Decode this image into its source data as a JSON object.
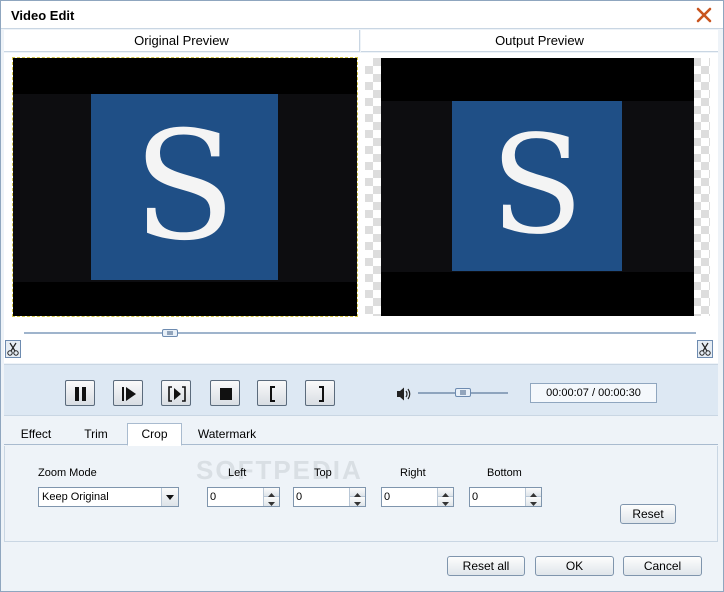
{
  "window": {
    "title": "Video Edit"
  },
  "preview": {
    "original_label": "Original Preview",
    "output_label": "Output Preview",
    "logo_letter": "S",
    "logo_color": "#1f4f86"
  },
  "playback": {
    "time_display": "00:00:07 / 00:00:30",
    "timeline_position": 0.22,
    "volume_level": 0.45
  },
  "tabs": [
    {
      "label": "Effect"
    },
    {
      "label": "Trim"
    },
    {
      "label": "Crop",
      "active": true
    },
    {
      "label": "Watermark"
    }
  ],
  "crop": {
    "zoom_mode_label": "Zoom Mode",
    "zoom_mode_value": "Keep Original",
    "left_label": "Left",
    "top_label": "Top",
    "right_label": "Right",
    "bottom_label": "Bottom",
    "left_value": "0",
    "top_value": "0",
    "right_value": "0",
    "bottom_value": "0",
    "reset_label": "Reset"
  },
  "footer": {
    "reset_all_label": "Reset all",
    "ok_label": "OK",
    "cancel_label": "Cancel"
  },
  "watermark_text": "SOFTPEDIA",
  "icons": [
    "close-icon",
    "scissors-icon",
    "pause-icon",
    "step-forward-icon",
    "frame-step-icon",
    "stop-icon",
    "mark-in-icon",
    "mark-out-icon",
    "volume-icon",
    "dropdown-arrow-icon",
    "spin-up-icon",
    "spin-down-icon"
  ]
}
